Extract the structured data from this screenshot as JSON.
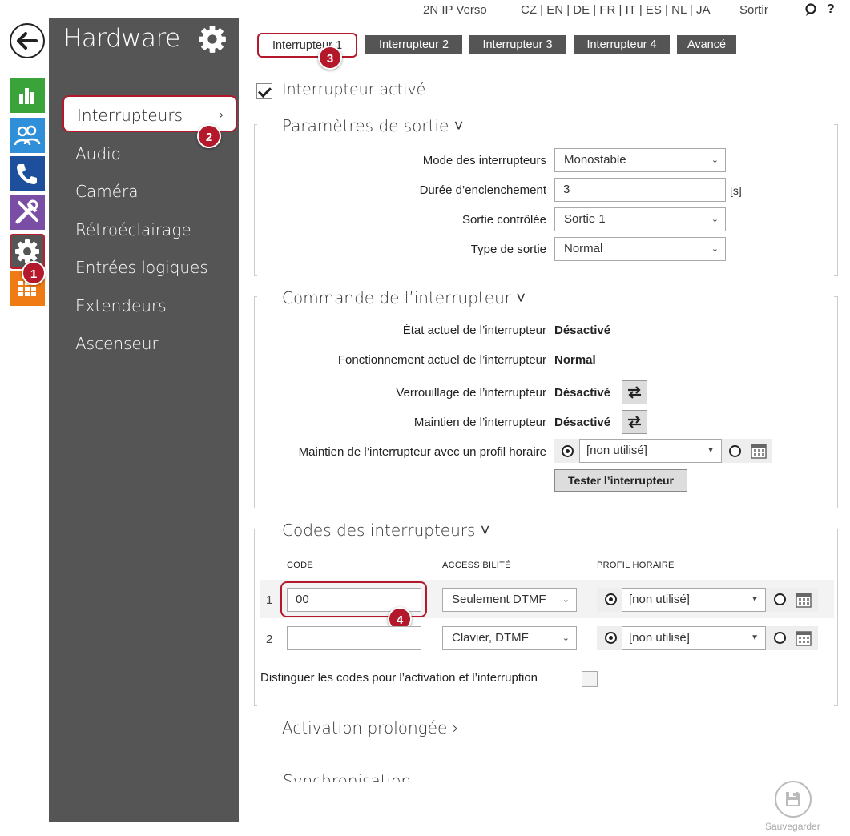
{
  "topbar": {
    "device": "2N IP Verso",
    "languages": "CZ | EN | DE | FR | IT | ES | NL | JA",
    "logout": "Sortir",
    "help": "?"
  },
  "rail": {
    "icons": [
      "back-arrow-icon",
      "stats-icon",
      "users-icon",
      "phone-icon",
      "tools-icon",
      "gear-icon",
      "grid-icon"
    ]
  },
  "menu": {
    "title": "Hardware",
    "items": [
      {
        "label": "Interrupteurs",
        "active": true
      },
      {
        "label": "Audio"
      },
      {
        "label": "Caméra"
      },
      {
        "label": "Rétroéclairage"
      },
      {
        "label": "Entrées logiques"
      },
      {
        "label": "Extendeurs"
      },
      {
        "label": "Ascenseur"
      }
    ],
    "chevron": "›"
  },
  "tabs": [
    "Interrupteur 1",
    "Interrupteur 2",
    "Interrupteur 3",
    "Interrupteur 4",
    "Avancé"
  ],
  "markers": [
    "1",
    "2",
    "3",
    "4"
  ],
  "switch_enabled": {
    "label": "Interrupteur activé",
    "checked": true
  },
  "output_section": {
    "title": "Paramètres de sortie ˅",
    "mode_label": "Mode des interrupteurs",
    "mode_value": "Monostable",
    "duration_label": "Durée d’enclenchement",
    "duration_value": "3",
    "duration_unit": "[s]",
    "output_label": "Sortie contrôlée",
    "output_value": "Sortie 1",
    "type_label": "Type de sortie",
    "type_value": "Normal"
  },
  "control_section": {
    "title": "Commande de l’interrupteur ˅",
    "state_label": "État actuel de l’interrupteur",
    "state_value": "Désactivé",
    "operation_label": "Fonctionnement actuel de l’interrupteur",
    "operation_value": "Normal",
    "lock_label": "Verrouillage de l’interrupteur",
    "lock_value": "Désactivé",
    "hold_label": "Maintien de l’interrupteur",
    "hold_value": "Désactivé",
    "profile_label": "Maintien de l’interrupteur avec un profil horaire",
    "profile_value": "[non utilisé]",
    "test_button": "Tester l’interrupteur"
  },
  "codes_section": {
    "title": "Codes des interrupteurs ˅",
    "col_code": "CODE",
    "col_access": "ACCESSIBILITÉ",
    "col_profile": "PROFIL HORAIRE",
    "rows": [
      {
        "num": "1",
        "code": "00",
        "access": "Seulement DTMF",
        "profile": "[non utilisé]"
      },
      {
        "num": "2",
        "code": "",
        "access": "Clavier, DTMF",
        "profile": "[non utilisé]"
      }
    ],
    "distinguish_label": "Distinguer les codes pour l’activation et l’interruption",
    "distinguish_checked": false
  },
  "extended": {
    "title": "Activation prolongée ›",
    "partial_title": "Synchronisation"
  },
  "save_label": "Sauvegarder"
}
